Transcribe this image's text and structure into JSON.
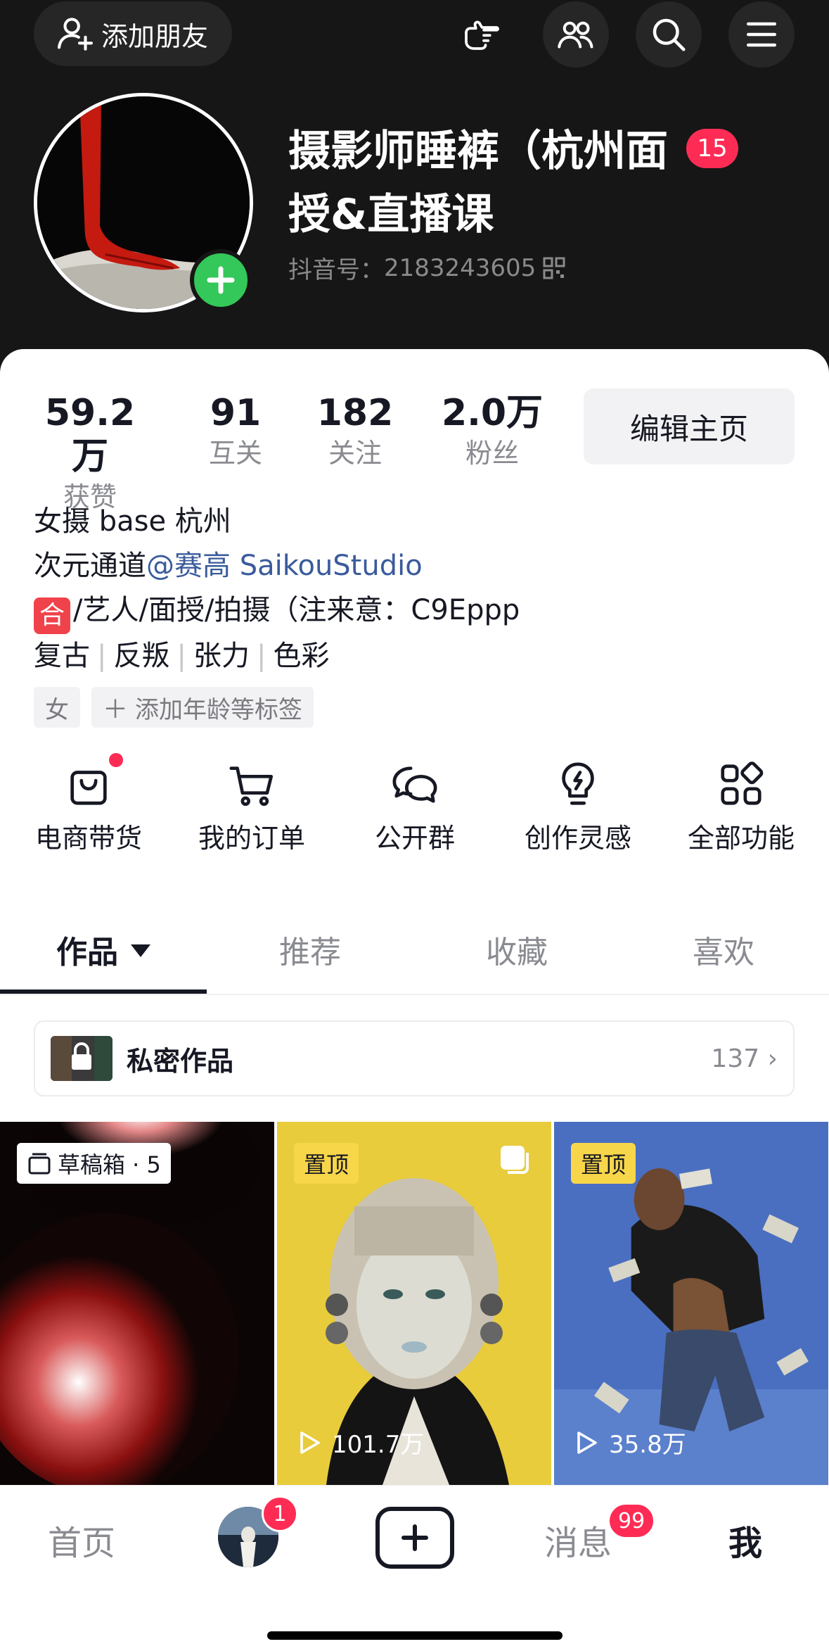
{
  "header": {
    "add_friend_label": "添加朋友",
    "icons": [
      "add-friend-icon",
      "pointing-hand-icon",
      "friends-icon",
      "search-icon",
      "menu-icon"
    ]
  },
  "profile": {
    "nickname": "摄影师睡裤（杭州面授&直播课",
    "badge_count": "15",
    "douyin_id_label": "抖音号：",
    "douyin_id": "2183243605"
  },
  "stats": [
    {
      "value": "59.2万",
      "label": "获赞"
    },
    {
      "value": "91",
      "label": "互关"
    },
    {
      "value": "182",
      "label": "关注"
    },
    {
      "value": "2.0万",
      "label": "粉丝"
    }
  ],
  "edit_button_label": "编辑主页",
  "bio": {
    "line1": "女摄 base 杭州",
    "line2_prefix": "次元通道",
    "line2_mention": "@赛高 SaikouStudio",
    "line3_icon": "合",
    "line3_text": "/艺人/面授/拍摄（注来意：C9Eppp",
    "line4_tags": [
      "复古",
      "反叛",
      "张力",
      "色彩"
    ],
    "separator": "|"
  },
  "profile_tags": {
    "gender": "女",
    "add_tag": "添加年龄等标签"
  },
  "features": [
    {
      "label": "电商带货",
      "icon": "shopping-bag-icon",
      "has_dot": true
    },
    {
      "label": "我的订单",
      "icon": "cart-icon",
      "has_dot": false
    },
    {
      "label": "公开群",
      "icon": "group-chat-icon",
      "has_dot": false
    },
    {
      "label": "创作灵感",
      "icon": "lightbulb-icon",
      "has_dot": false
    },
    {
      "label": "全部功能",
      "icon": "grid-apps-icon",
      "has_dot": false
    }
  ],
  "tabs": [
    {
      "label": "作品",
      "active": true
    },
    {
      "label": "推荐",
      "active": false
    },
    {
      "label": "收藏",
      "active": false
    },
    {
      "label": "喜欢",
      "active": false
    }
  ],
  "private_works": {
    "label": "私密作品",
    "count": "137"
  },
  "videos": [
    {
      "badge": "草稿箱 · 5",
      "plays": ""
    },
    {
      "badge": "置顶",
      "plays": "101.7万"
    },
    {
      "badge": "置顶",
      "plays": "35.8万"
    }
  ],
  "bottom_nav": {
    "home": "首页",
    "avatar_badge": "1",
    "messages": "消息",
    "messages_badge": "99",
    "me": "我"
  },
  "colors": {
    "header_bg": "#161616",
    "accent_red": "#fe2c55",
    "follow_green": "#34c759",
    "pin_yellow": "#f8d64a",
    "mention_blue": "#3a5b9c"
  }
}
